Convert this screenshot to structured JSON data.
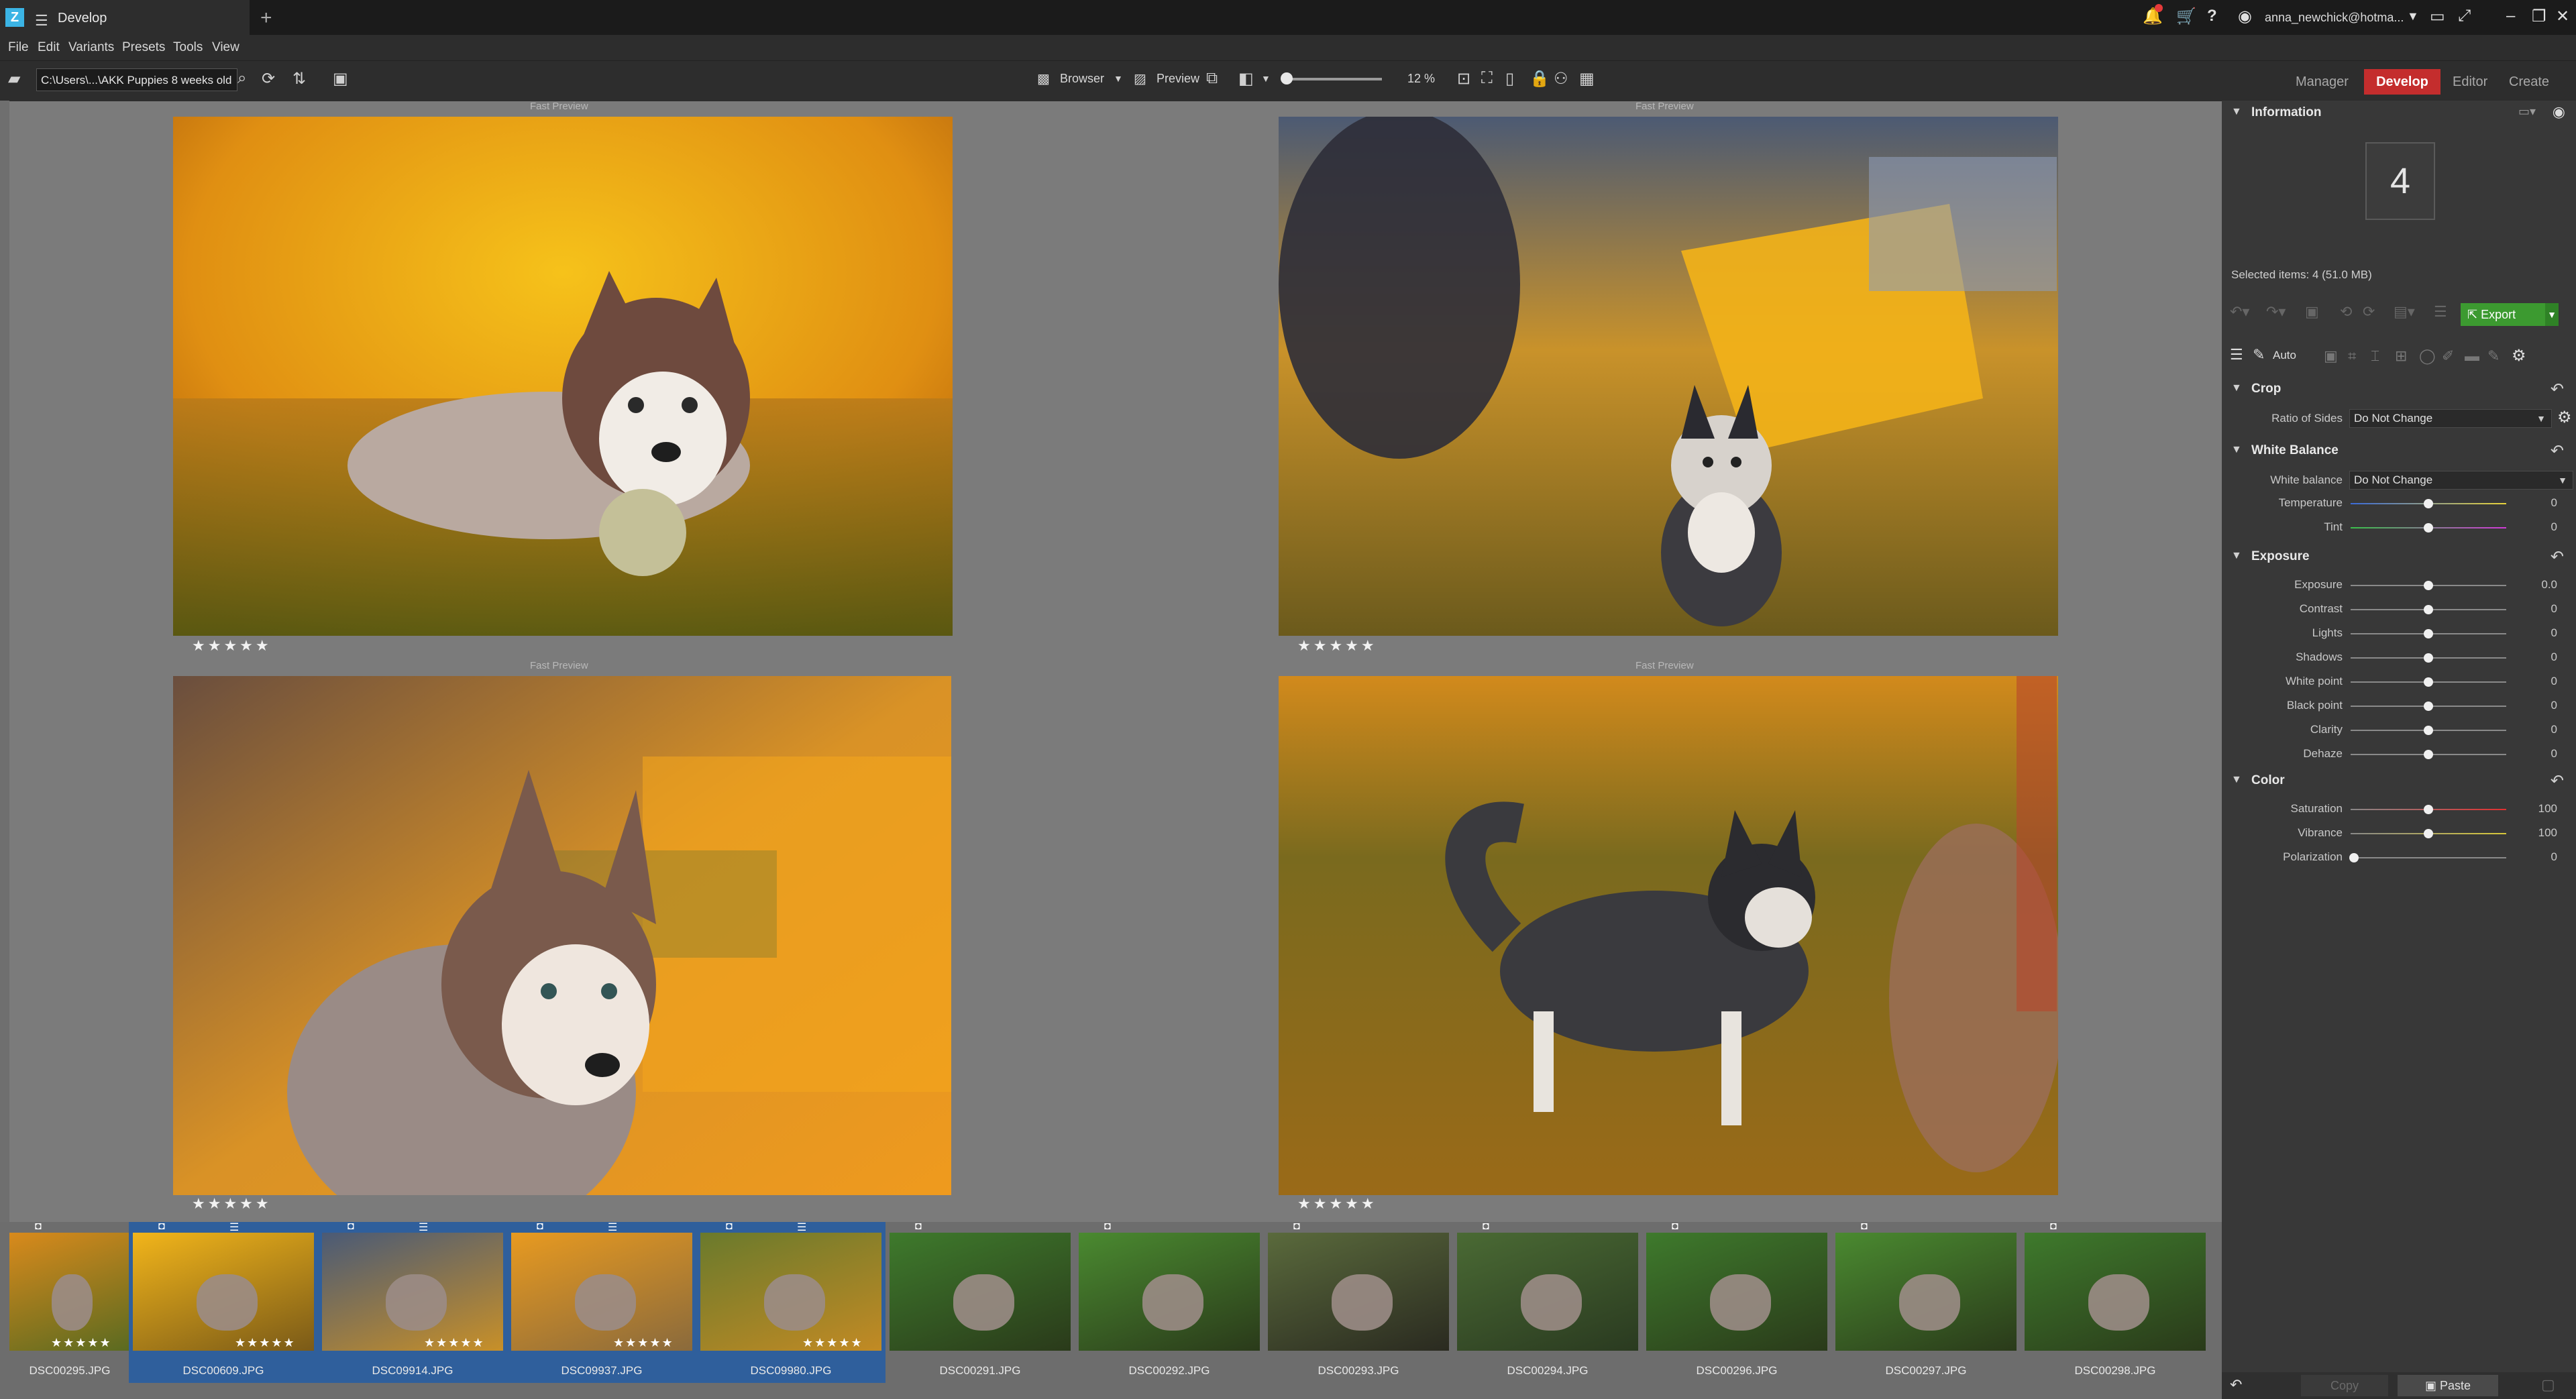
{
  "app": {
    "tab_title": "Develop"
  },
  "user": {
    "name": "anna_newchick@hotma..."
  },
  "menu": [
    "File",
    "Edit",
    "Variants",
    "Presets",
    "Tools",
    "View"
  ],
  "toolbar": {
    "path": "C:\\Users\\...\\AKK Puppies 8 weeks old",
    "browser_label": "Browser",
    "preview_label": "Preview",
    "zoom": "12 %",
    "zoom_fraction": 0.05
  },
  "modes": {
    "manager": "Manager",
    "develop": "Develop",
    "editor": "Editor",
    "create": "Create"
  },
  "previews": [
    {
      "label": "Fast Preview",
      "stars": "★★★★★"
    },
    {
      "label": "Fast Preview",
      "stars": "★★★★★"
    },
    {
      "label": "Fast Preview",
      "stars": "★★★★★"
    },
    {
      "label": "Fast Preview",
      "stars": "★★★★★"
    }
  ],
  "info": {
    "title": "Information",
    "count": "4",
    "selected": "Selected items: 4 (51.0 MB)",
    "export_label": "Export",
    "auto_label": "Auto"
  },
  "crop": {
    "title": "Crop",
    "ratio_label": "Ratio of Sides",
    "ratio_value": "Do Not Change"
  },
  "white_balance": {
    "title": "White Balance",
    "wb_label": "White balance",
    "wb_value": "Do Not Change",
    "sliders": [
      {
        "label": "Temperature",
        "value": "0",
        "pos": 0.5
      },
      {
        "label": "Tint",
        "value": "0",
        "pos": 0.5
      }
    ]
  },
  "exposure": {
    "title": "Exposure",
    "sliders": [
      {
        "label": "Exposure",
        "value": "0.0",
        "pos": 0.5
      },
      {
        "label": "Contrast",
        "value": "0",
        "pos": 0.5
      },
      {
        "label": "Lights",
        "value": "0",
        "pos": 0.5
      },
      {
        "label": "Shadows",
        "value": "0",
        "pos": 0.5
      },
      {
        "label": "White point",
        "value": "0",
        "pos": 0.5
      },
      {
        "label": "Black point",
        "value": "0",
        "pos": 0.5
      },
      {
        "label": "Clarity",
        "value": "0",
        "pos": 0.5
      },
      {
        "label": "Dehaze",
        "value": "0",
        "pos": 0.5
      }
    ]
  },
  "color": {
    "title": "Color",
    "sliders": [
      {
        "label": "Saturation",
        "value": "100",
        "pos": 0.5
      },
      {
        "label": "Vibrance",
        "value": "100",
        "pos": 0.5
      },
      {
        "label": "Polarization",
        "value": "0",
        "pos": 0.02
      }
    ]
  },
  "bottom": {
    "copy_label": "Copy",
    "paste_label": "Paste"
  },
  "filmstrip": [
    {
      "name": "DSC00295.JPG",
      "stars": "★★★★★",
      "selected": false
    },
    {
      "name": "DSC00609.JPG",
      "stars": "★★★★★",
      "selected": true
    },
    {
      "name": "DSC09914.JPG",
      "stars": "★★★★★",
      "selected": true
    },
    {
      "name": "DSC09937.JPG",
      "stars": "★★★★★",
      "selected": true
    },
    {
      "name": "DSC09980.JPG",
      "stars": "★★★★★",
      "selected": true
    },
    {
      "name": "DSC00291.JPG",
      "stars": "",
      "selected": false
    },
    {
      "name": "DSC00292.JPG",
      "stars": "",
      "selected": false
    },
    {
      "name": "DSC00293.JPG",
      "stars": "",
      "selected": false
    },
    {
      "name": "DSC00294.JPG",
      "stars": "",
      "selected": false
    },
    {
      "name": "DSC00296.JPG",
      "stars": "",
      "selected": false
    },
    {
      "name": "DSC00297.JPG",
      "stars": "",
      "selected": false
    },
    {
      "name": "DSC00298.JPG",
      "stars": "",
      "selected": false
    }
  ],
  "colors": {
    "accent_develop": "#c42d2d",
    "export_green": "#3c9a30",
    "selection_blue": "#2f5f9c"
  }
}
